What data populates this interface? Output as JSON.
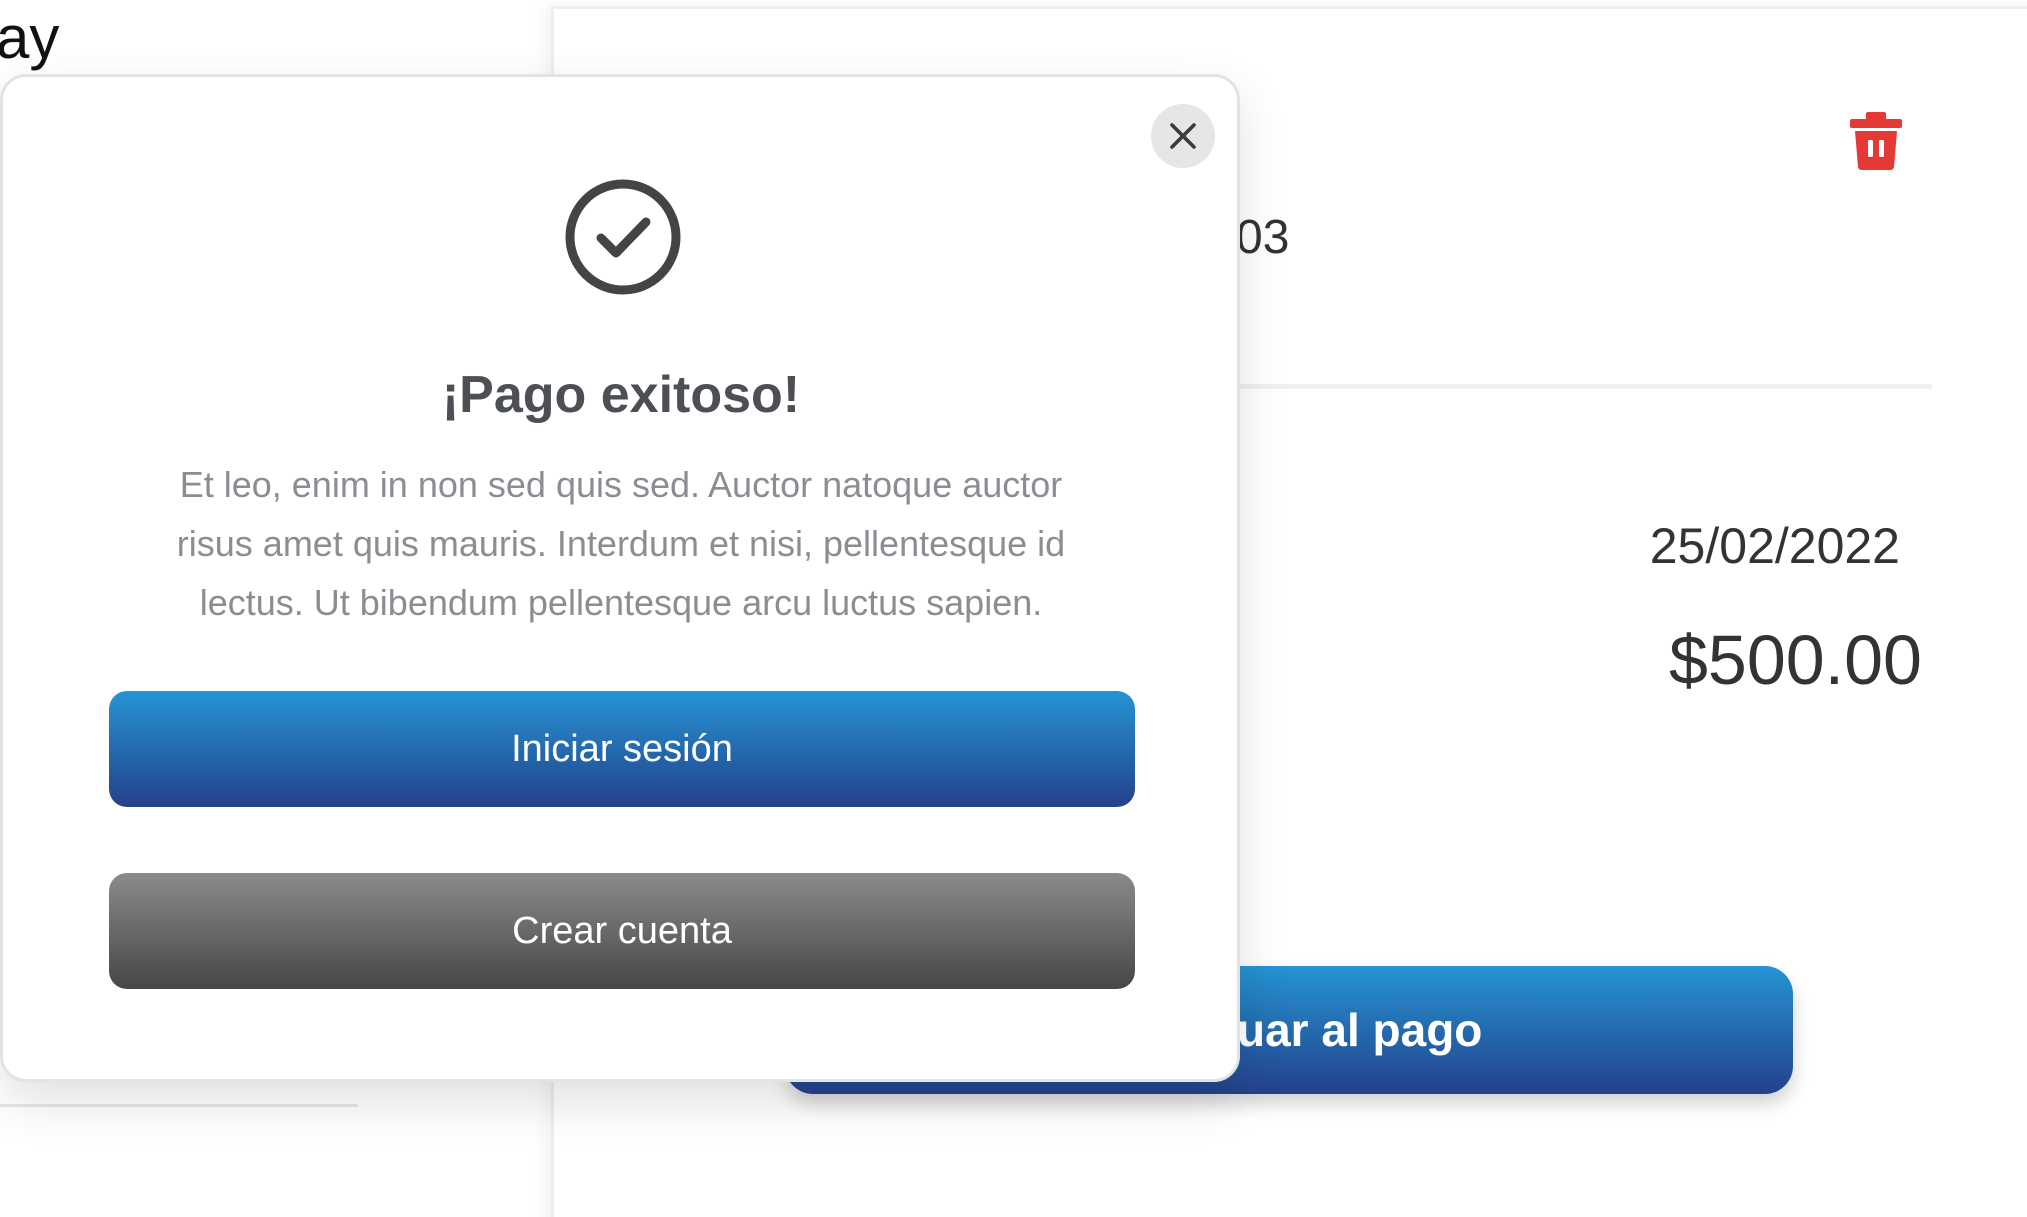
{
  "background": {
    "left_text": "ay",
    "order_number_fragment": "03",
    "date": "25/02/2022",
    "amount": "$500.00",
    "pay_button_label_fragment": "uar al pago",
    "trash_icon": "trash-icon",
    "trash_color": "#e53935"
  },
  "modal": {
    "close_icon": "close-icon",
    "success_icon": "check-circle-icon",
    "title": "¡Pago exitoso!",
    "body_lines": [
      "Et leo, enim in non sed quis sed. Auctor natoque auctor",
      "risus amet quis mauris. Interdum et nisi, pellentesque id",
      "lectus. Ut bibendum pellentesque arcu luctus sapien."
    ],
    "primary_button_label": "Iniciar sesión",
    "secondary_button_label": "Crear cuenta"
  },
  "colors": {
    "primary_gradient_top": "#2594d3",
    "primary_gradient_bottom": "#24418a",
    "secondary_gradient_top": "#8b8b8b",
    "secondary_gradient_bottom": "#464646",
    "icon_dark": "#444444",
    "title_text": "#4c4f54",
    "body_text": "#8a8d91"
  }
}
